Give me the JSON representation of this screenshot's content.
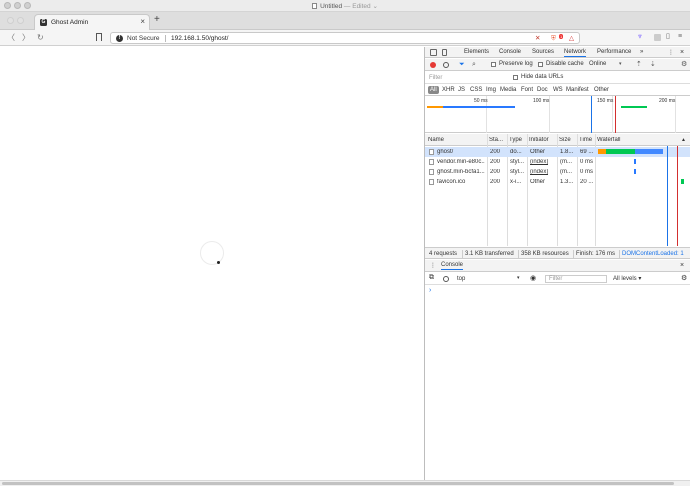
{
  "window": {
    "title": "Untitled",
    "title_suffix": "— Edited",
    "caret": "⌄"
  },
  "tab": {
    "title": "Ghost Admin",
    "favicon_letter": "G",
    "close": "×",
    "new_tab": "+"
  },
  "nav": {
    "back": "〈",
    "forward": "〉",
    "reload": "↻",
    "security_label": "Not Secure",
    "url": "192.168.1.50/ghost/",
    "brave_count": "1",
    "menu": "≡"
  },
  "devtools": {
    "tabs": [
      "Elements",
      "Console",
      "Sources",
      "Network",
      "Performance"
    ],
    "active_tab": "Network",
    "more_tabs": "»",
    "kebab": "⋮",
    "close": "×",
    "toolbar": {
      "preserve_log": "Preserve log",
      "disable_cache": "Disable cache",
      "throttle": "Online",
      "throttle_caret": "▾"
    },
    "filter_placeholder": "Filter",
    "hide_data_urls": "Hide data URLs",
    "types": [
      "All",
      "XHR",
      "JS",
      "CSS",
      "Img",
      "Media",
      "Font",
      "Doc",
      "WS",
      "Manifest",
      "Other"
    ],
    "active_type": "All",
    "timeline_ticks": [
      "50 ms",
      "100 ms",
      "150 ms",
      "200 ms"
    ],
    "columns": [
      "Name",
      "Sta...",
      "Type",
      "Initiator",
      "Size",
      "Time",
      "Waterfall"
    ],
    "sort_arrow": "▲",
    "rows": [
      {
        "name": "ghost/",
        "status": "200",
        "type": "do...",
        "initiator": "Other",
        "size": "1.8...",
        "time": "69 ...",
        "selected": true
      },
      {
        "name": "vendor.min-e80c...",
        "status": "200",
        "type": "styl...",
        "initiator": "(index)",
        "size": "(m...",
        "time": "0 ms",
        "selected": false
      },
      {
        "name": "ghost.min-bcfa1...",
        "status": "200",
        "type": "styl...",
        "initiator": "(index)",
        "size": "(m...",
        "time": "0 ms",
        "selected": false
      },
      {
        "name": "favicon.ico",
        "status": "200",
        "type": "x-i...",
        "initiator": "Other",
        "size": "1.3...",
        "time": "20 ...",
        "selected": false
      }
    ],
    "status": {
      "requests": "4 requests",
      "transferred": "3.1 KB transferred",
      "resources": "358 KB resources",
      "finish": "Finish: 176 ms",
      "dom_loaded": "DOMContentLoaded: 1"
    },
    "colors": {
      "accent": "#1a73e8",
      "record": "#e53935",
      "dom_line": "#1a73e8",
      "load_line": "#d32f2f",
      "wait": "#ff9800",
      "download": "#00c853"
    },
    "console": {
      "tab": "Console",
      "context": "top",
      "context_caret": "▾",
      "filter_placeholder": "Filter",
      "levels": "All levels ▾",
      "prompt": "›"
    }
  }
}
